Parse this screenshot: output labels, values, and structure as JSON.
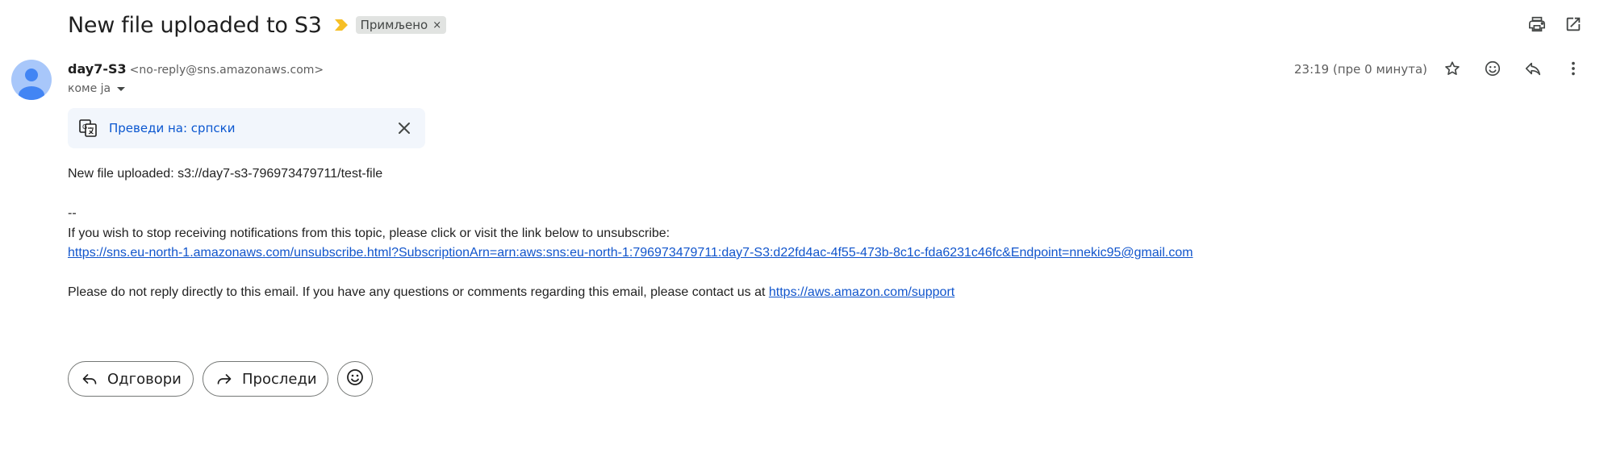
{
  "email": {
    "subject": "New file uploaded to S3",
    "label": "Примљено",
    "label_remove": "×",
    "sender_name": "day7-S3",
    "sender_email": "<no-reply@sns.amazonaws.com>",
    "to_line": "коме ја",
    "timestamp": "23:19 (пре 0 минута)"
  },
  "translate": {
    "link_text": "Преведи на: српски"
  },
  "body": {
    "line1": "New file uploaded: s3://day7-s3-796973479711/test-file",
    "separator": "--",
    "unsubscribe_text": "If you wish to stop receiving notifications from this topic, please click or visit the link below to unsubscribe:",
    "unsubscribe_link": "https://sns.eu-north-1.amazonaws.com/unsubscribe.html?SubscriptionArn=arn:aws:sns:eu-north-1:796973479711:day7-S3:d22fd4ac-4f55-473b-8c1c-fda6231c46fc&Endpoint=nnekic95@gmail.com",
    "contact_text": "Please do not reply directly to this email. If you have any questions or comments regarding this email, please contact us at ",
    "contact_link": "https://aws.amazon.com/support"
  },
  "actions": {
    "reply_label": "Одговори",
    "forward_label": "Проследи"
  },
  "icons": {
    "print": "printer-icon",
    "open_new": "open-in-new-window-icon",
    "star": "star-icon",
    "emoji": "emoji-icon",
    "reply": "reply-icon",
    "more": "more-vertical-icon",
    "importance": "importance-marker-icon",
    "translate": "translate-icon",
    "close": "close-icon"
  },
  "colors": {
    "importance": "#f6bf26",
    "link": "#1155cc",
    "translate_link": "#0b57d0",
    "avatar": "#a8c7fa",
    "avatar_figure": "#4285f4"
  }
}
